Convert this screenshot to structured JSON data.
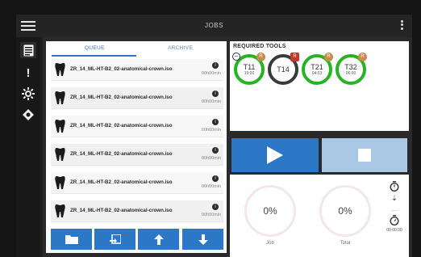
{
  "window": {
    "title": "JOBS"
  },
  "sidebar": {
    "items": [
      {
        "name": "jobs",
        "icon": "list-icon",
        "active": true
      },
      {
        "name": "alerts",
        "icon": "exclamation-icon",
        "active": false
      },
      {
        "name": "settings",
        "icon": "gear-icon",
        "active": false
      },
      {
        "name": "tools",
        "icon": "tool-icon",
        "active": false
      }
    ]
  },
  "queue": {
    "tabs": [
      "QUEUE",
      "ARCHIVE"
    ],
    "active_tab": "QUEUE",
    "items": [
      {
        "name": "ZR_14_ML-HT-B2_02-anatomical-crown.iso",
        "duration": "00h00min"
      },
      {
        "name": "ZR_14_ML-HT-B2_02-anatomical-crown.iso",
        "duration": "00h00min"
      },
      {
        "name": "ZR_14_ML-HT-B2_02-anatomical-crown.iso",
        "duration": "00h00min"
      },
      {
        "name": "ZR_14_ML-HT-B2_02-anatomical-crown.iso",
        "duration": "00h00min"
      },
      {
        "name": "ZR_14_ML-HT-B2_02-anatomical-crown.iso",
        "duration": "00h00min"
      },
      {
        "name": "ZR_14_ML-HT-B2_02-anatomical-crown.iso",
        "duration": "00h00min"
      }
    ],
    "actions": [
      {
        "name": "open-folder",
        "icon": "folder-icon"
      },
      {
        "name": "import",
        "icon": "import-icon"
      },
      {
        "name": "move-up",
        "icon": "arrow-up-icon"
      },
      {
        "name": "move-down",
        "icon": "arrow-down-icon"
      }
    ]
  },
  "tools": {
    "header": "REQUIRED TOOLS",
    "items": [
      {
        "name": "T11",
        "value": "19:00",
        "status": "green",
        "badge": "R",
        "minus": true
      },
      {
        "name": "T14",
        "value": "",
        "status": "dark",
        "badge": "R",
        "badge_color": "red"
      },
      {
        "name": "T21",
        "value": "04:03",
        "status": "green",
        "badge": "R"
      },
      {
        "name": "T32",
        "value": "06:00",
        "status": "green",
        "badge": "R"
      }
    ]
  },
  "controls": {
    "play_icon": "play-icon",
    "stop_icon": "stop-icon"
  },
  "progress": {
    "job": {
      "value": "0%",
      "label": "Job"
    },
    "total": {
      "value": "0%",
      "label": "Total"
    },
    "side_time": "00:00:00"
  },
  "colors": {
    "accent": "#2d78c6",
    "tool_ok": "#27b423",
    "badge": "#c98d4a"
  }
}
